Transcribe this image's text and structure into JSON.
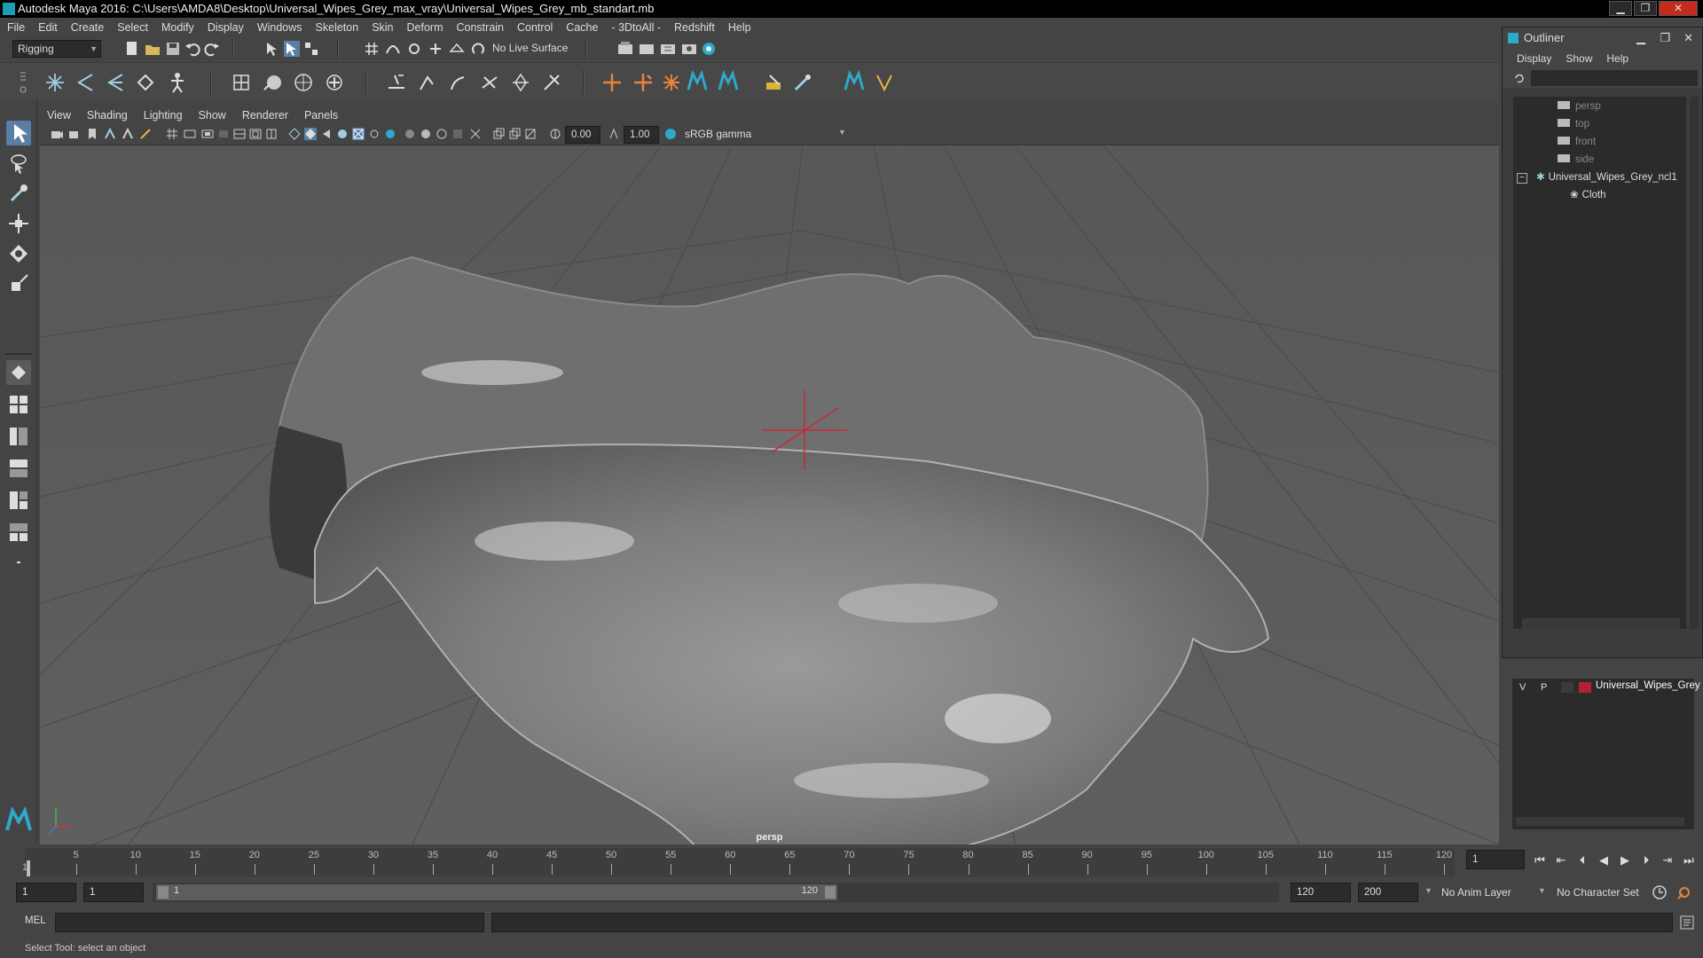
{
  "window": {
    "title": "Autodesk Maya 2016: C:\\Users\\AMDA8\\Desktop\\Universal_Wipes_Grey_max_vray\\Universal_Wipes_Grey_mb_standart.mb",
    "minimize": "▁",
    "restore": "❐",
    "close": "✕"
  },
  "menu": [
    "File",
    "Edit",
    "Create",
    "Select",
    "Modify",
    "Display",
    "Windows",
    "Skeleton",
    "Skin",
    "Deform",
    "Constrain",
    "Control",
    "Cache",
    "- 3DtoAll -",
    "Redshift",
    "Help"
  ],
  "statusline": {
    "menuset": "Rigging",
    "live_surface": "No Live Surface"
  },
  "panel": {
    "menu": [
      "View",
      "Shading",
      "Lighting",
      "Show",
      "Renderer",
      "Panels"
    ],
    "near_value": "0.00",
    "far_value": "1.00",
    "color_space": "sRGB gamma",
    "camera": "persp"
  },
  "outliner": {
    "title": "Outliner",
    "menu": [
      "Display",
      "Show",
      "Help"
    ],
    "items": [
      {
        "label": "persp",
        "dim": true
      },
      {
        "label": "top",
        "dim": true
      },
      {
        "label": "front",
        "dim": true
      },
      {
        "label": "side",
        "dim": true
      },
      {
        "label": "Universal_Wipes_Grey_ncl1",
        "dim": false
      },
      {
        "label": "Cloth",
        "dim": false
      }
    ],
    "collapse_glyph": "−"
  },
  "layers": {
    "v": "V",
    "p": "P",
    "layer_name": "Universal_Wipes_Grey",
    "layer_color": "#b3203a"
  },
  "timeslider": {
    "ticks": [
      "1",
      "5",
      "10",
      "15",
      "20",
      "25",
      "30",
      "35",
      "40",
      "45",
      "50",
      "55",
      "60",
      "65",
      "70",
      "75",
      "80",
      "85",
      "90",
      "95",
      "100",
      "105",
      "110",
      "115",
      "120"
    ],
    "current_frame": "1"
  },
  "range": {
    "start": "1",
    "playback_start": "1",
    "slider_start": "1",
    "slider_end": "120",
    "playback_end": "120",
    "end": "200",
    "anim_layer": "No Anim Layer",
    "character_set": "No Character Set"
  },
  "cmdline": {
    "label": "MEL"
  },
  "helpline": {
    "text": "Select Tool: select an object"
  },
  "icons": {
    "accent": "#2ea9c9"
  }
}
